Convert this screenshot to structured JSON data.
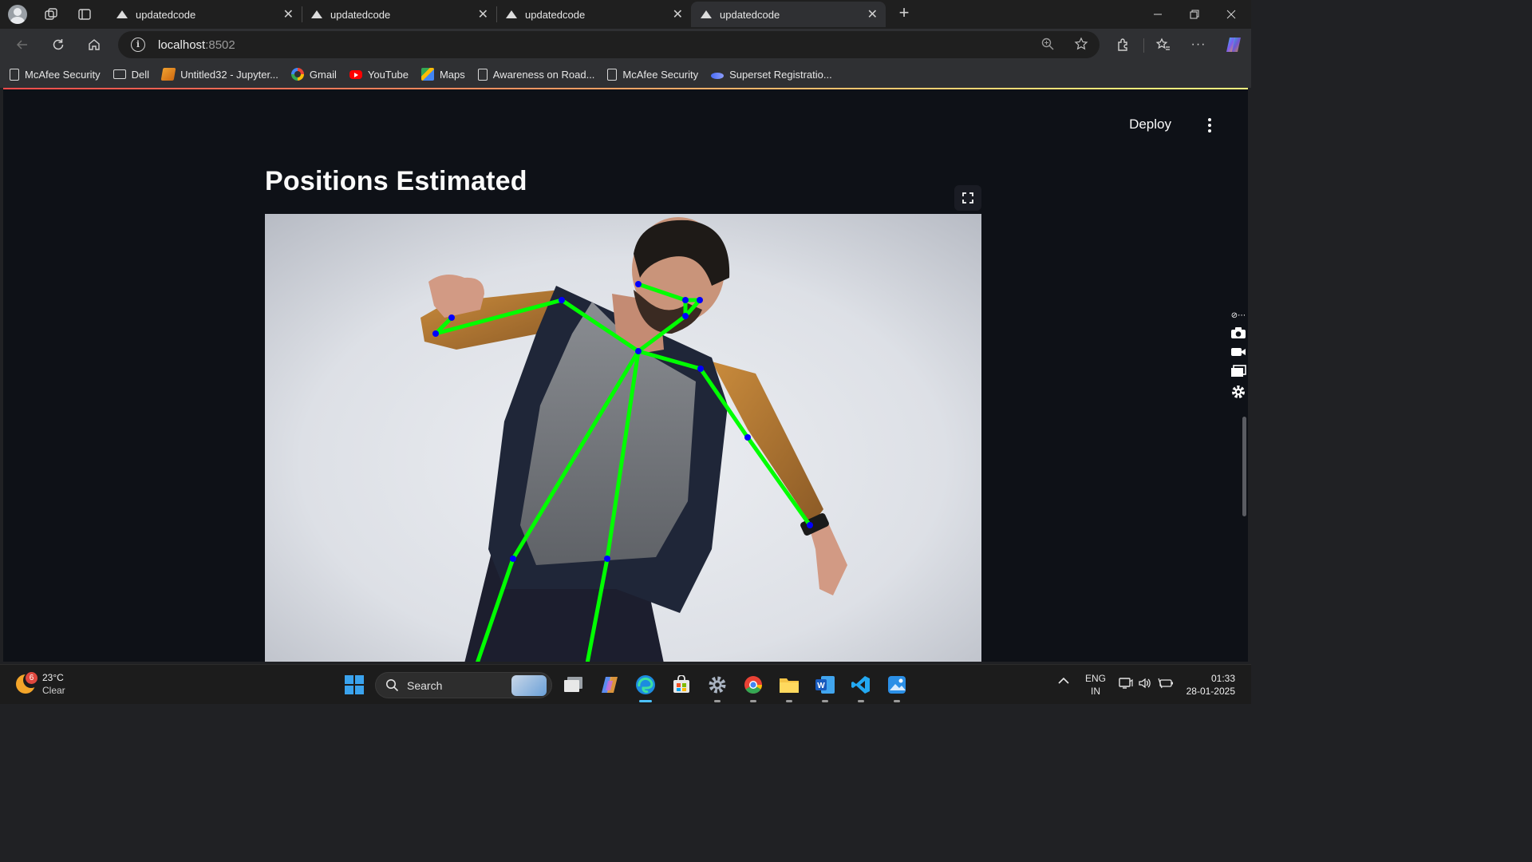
{
  "browser": {
    "tabs": [
      {
        "title": "updatedcode",
        "active": false
      },
      {
        "title": "updatedcode",
        "active": false
      },
      {
        "title": "updatedcode",
        "active": false
      },
      {
        "title": "updatedcode",
        "active": true
      }
    ],
    "url_host": "localhost",
    "url_port": ":8502",
    "bookmarks": [
      {
        "label": "McAfee Security",
        "icon": "document-icon"
      },
      {
        "label": "Dell",
        "icon": "folder-icon"
      },
      {
        "label": "Untitled32 - Jupyter...",
        "icon": "jupyter-icon"
      },
      {
        "label": "Gmail",
        "icon": "google-icon"
      },
      {
        "label": "YouTube",
        "icon": "youtube-icon"
      },
      {
        "label": "Maps",
        "icon": "maps-icon"
      },
      {
        "label": "Awareness on Road...",
        "icon": "document-icon"
      },
      {
        "label": "McAfee Security",
        "icon": "document-icon"
      },
      {
        "label": "Superset Registratio...",
        "icon": "superset-icon"
      }
    ]
  },
  "app": {
    "deploy_label": "Deploy",
    "title": "Positions Estimated",
    "accent_gradient": [
      "#ff4b4b",
      "#fffd80"
    ],
    "background": "#0e1117"
  },
  "taskbar": {
    "weather_badge": "6",
    "temperature": "23°C",
    "condition": "Clear",
    "search_label": "Search",
    "lang_line1": "ENG",
    "lang_line2": "IN",
    "time": "01:33",
    "date": "28-01-2025"
  }
}
